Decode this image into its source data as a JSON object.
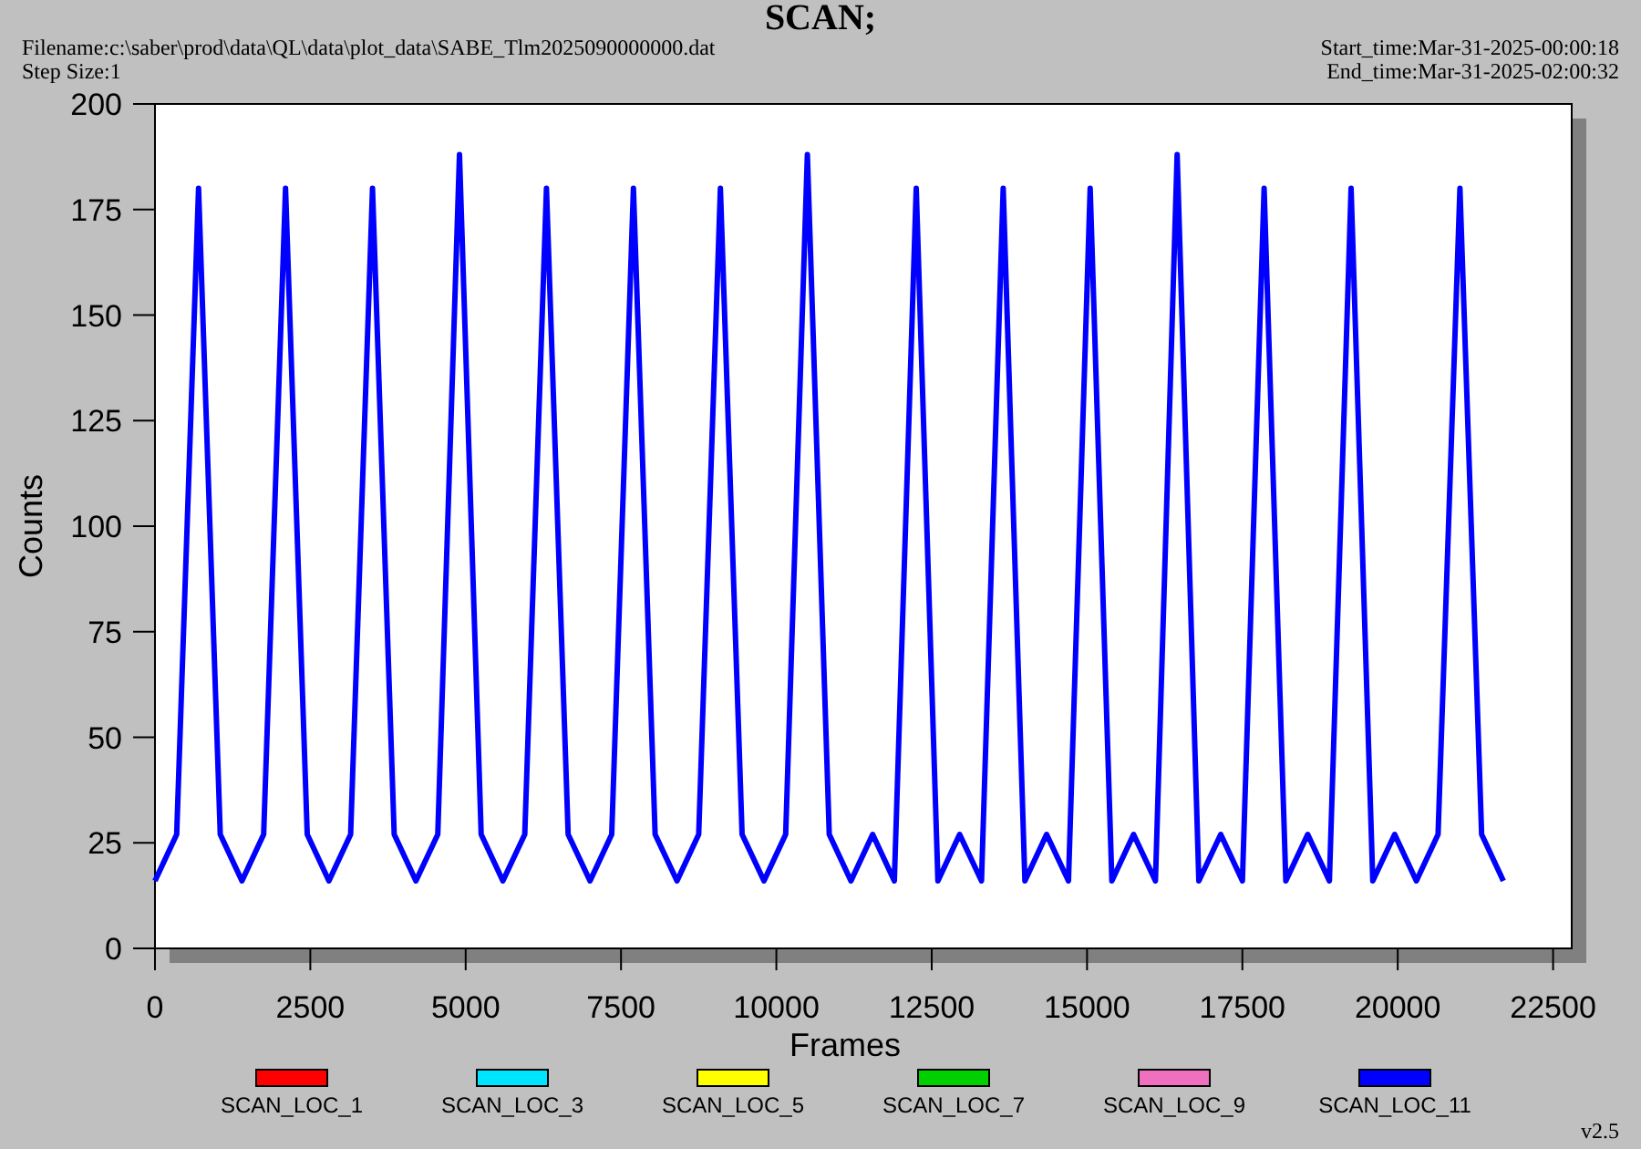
{
  "title": "SCAN;",
  "header": {
    "filename": "Filename:c:\\saber\\prod\\data\\QL\\data\\plot_data\\SABE_Tlm2025090000000.dat",
    "step_size": "Step Size:1",
    "start_time": "Start_time:Mar-31-2025-00:00:18",
    "end_time": "End_time:Mar-31-2025-02:00:32"
  },
  "chart_data": {
    "type": "line",
    "xlabel": "Frames",
    "ylabel": "Counts",
    "xlim": [
      0,
      22800
    ],
    "ylim": [
      0,
      200
    ],
    "xticks": [
      0,
      2500,
      5000,
      7500,
      10000,
      12500,
      15000,
      17500,
      20000,
      22500
    ],
    "yticks": [
      0,
      25,
      50,
      75,
      100,
      125,
      150,
      175,
      200
    ],
    "x": [
      0,
      350,
      700,
      1050,
      1400,
      1750,
      2100,
      2450,
      2800,
      3150,
      3500,
      3850,
      4200,
      4550,
      4900,
      5250,
      5600,
      5950,
      6300,
      6650,
      7000,
      7350,
      7700,
      8050,
      8400,
      8750,
      9100,
      9450,
      9800,
      10150,
      10500,
      10850,
      11200,
      11550,
      11900,
      12250,
      12600,
      12950,
      13300,
      13650,
      14000,
      14350,
      14700,
      15050,
      15400,
      15750,
      16100,
      16450,
      16800,
      17150,
      17500,
      17850,
      18200,
      18550,
      18900,
      19250,
      19600,
      19950,
      20300,
      20650,
      21000,
      21350,
      21700
    ],
    "series": [
      {
        "name": "SCAN_LOC_1",
        "color": "#ff0000",
        "values": [
          null,
          null,
          null,
          null,
          null,
          null,
          null,
          null,
          null,
          null,
          null,
          null,
          null,
          null,
          null,
          null,
          null,
          null,
          null,
          null,
          null,
          null,
          null,
          null,
          null,
          null,
          null,
          null,
          null,
          null,
          null,
          null,
          null,
          null,
          null,
          null,
          null,
          null,
          null,
          null,
          null,
          null,
          null,
          null,
          null,
          null,
          null,
          null,
          null,
          null,
          null,
          null,
          null,
          null,
          null,
          null,
          null,
          null,
          null,
          null,
          null,
          null,
          null
        ]
      },
      {
        "name": "SCAN_LOC_3",
        "color": "#00e5ff",
        "values": [
          null,
          null,
          null,
          null,
          null,
          null,
          null,
          null,
          null,
          null,
          null,
          null,
          null,
          null,
          null,
          null,
          null,
          null,
          null,
          null,
          null,
          null,
          null,
          null,
          null,
          null,
          null,
          null,
          null,
          null,
          null,
          null,
          null,
          null,
          null,
          null,
          null,
          null,
          null,
          null,
          null,
          null,
          null,
          null,
          null,
          null,
          null,
          null,
          null,
          null,
          null,
          null,
          null,
          null,
          null,
          null,
          null,
          null,
          null,
          null,
          null,
          null,
          null
        ]
      },
      {
        "name": "SCAN_LOC_5",
        "color": "#ffff00",
        "values": [
          null,
          null,
          null,
          null,
          null,
          null,
          null,
          null,
          null,
          null,
          null,
          null,
          null,
          null,
          null,
          null,
          null,
          null,
          null,
          null,
          null,
          null,
          null,
          null,
          null,
          null,
          null,
          null,
          null,
          null,
          null,
          null,
          null,
          null,
          null,
          null,
          null,
          null,
          null,
          null,
          null,
          null,
          null,
          null,
          null,
          null,
          null,
          null,
          null,
          null,
          null,
          null,
          null,
          null,
          null,
          null,
          null,
          null,
          null,
          null,
          null,
          null,
          null
        ]
      },
      {
        "name": "SCAN_LOC_7",
        "color": "#00d000",
        "values": [
          null,
          null,
          null,
          null,
          null,
          null,
          null,
          null,
          null,
          null,
          null,
          null,
          null,
          null,
          null,
          null,
          null,
          null,
          null,
          null,
          null,
          null,
          null,
          null,
          null,
          null,
          null,
          null,
          null,
          null,
          null,
          null,
          null,
          null,
          null,
          null,
          null,
          null,
          null,
          null,
          null,
          null,
          null,
          null,
          null,
          null,
          null,
          null,
          null,
          null,
          null,
          null,
          null,
          null,
          null,
          null,
          null,
          null,
          null,
          null,
          null,
          null,
          null
        ]
      },
      {
        "name": "SCAN_LOC_9",
        "color": "#f070c0",
        "values": [
          null,
          null,
          null,
          null,
          null,
          null,
          null,
          null,
          null,
          null,
          null,
          null,
          null,
          null,
          null,
          null,
          null,
          null,
          null,
          null,
          null,
          null,
          null,
          null,
          null,
          null,
          null,
          null,
          null,
          null,
          null,
          null,
          null,
          null,
          null,
          null,
          null,
          null,
          null,
          null,
          null,
          null,
          null,
          null,
          null,
          null,
          null,
          null,
          null,
          null,
          null,
          null,
          null,
          null,
          null,
          null,
          null,
          null,
          null,
          null,
          null,
          null,
          null
        ]
      },
      {
        "name": "SCAN_LOC_11",
        "color": "#0000ff",
        "values": [
          16,
          27,
          180,
          27,
          16,
          27,
          180,
          27,
          16,
          27,
          180,
          27,
          16,
          27,
          188,
          27,
          16,
          27,
          180,
          27,
          16,
          27,
          180,
          27,
          16,
          27,
          180,
          27,
          16,
          27,
          188,
          27,
          16,
          27,
          16,
          180,
          16,
          27,
          16,
          180,
          16,
          27,
          16,
          180,
          16,
          27,
          16,
          188,
          16,
          27,
          16,
          180,
          16,
          27,
          16,
          180,
          16,
          27,
          16,
          27,
          180,
          27,
          16
        ]
      }
    ]
  },
  "version": "v2.5"
}
